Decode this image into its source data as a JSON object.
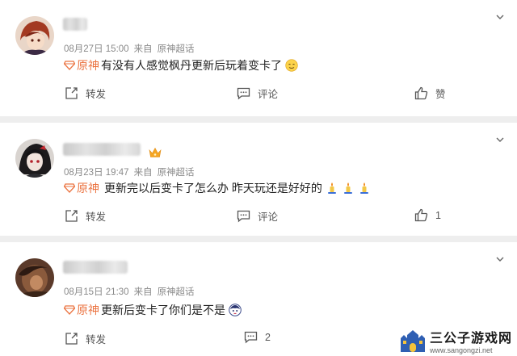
{
  "topic_label": "原神",
  "comments": [
    {
      "date": "08月27日 15:00",
      "source_prefix": "来自",
      "source": "原神超话",
      "text": "有没有人感觉枫丹更新后玩着变卡了",
      "emojis": [
        "sweat-smile"
      ],
      "repost_label": "转发",
      "comment_label": "评论",
      "like_label": "赞"
    },
    {
      "date": "08月23日 19:47",
      "source_prefix": "来自",
      "source": "原神超话",
      "text": "更新完以后变卡了怎么办 昨天玩还是好好的",
      "emojis": [
        "candle",
        "candle",
        "candle"
      ],
      "repost_label": "转发",
      "comment_label": "评论",
      "like_count": "1"
    },
    {
      "date": "08月15日 21:30",
      "source_prefix": "来自",
      "source": "原神超话",
      "text": "更新后变卡了你们是不是",
      "emojis": [
        "character"
      ],
      "repost_label": "转发",
      "comment_count": "2"
    }
  ],
  "watermark": {
    "title": "三公子游戏网",
    "url": "www.sangongzi.net"
  },
  "colors": {
    "topic": "#eb7340",
    "meta": "#8a8a8a",
    "divider": "#eeeeee"
  }
}
